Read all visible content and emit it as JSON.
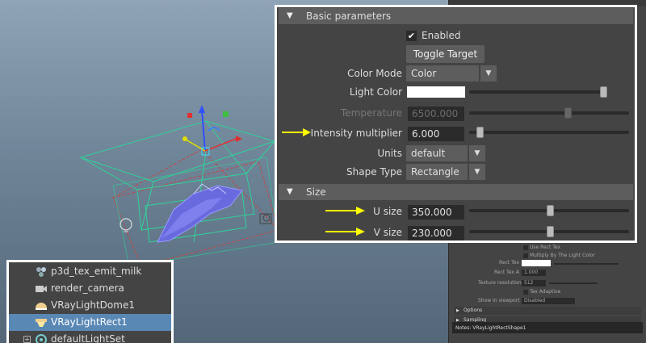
{
  "basic_parameters": {
    "header": "Basic parameters",
    "enabled_label": "Enabled",
    "enabled_checked": true,
    "toggle_target_label": "Toggle Target",
    "color_mode": {
      "label": "Color Mode",
      "value": "Color"
    },
    "light_color": {
      "label": "Light Color",
      "color": "#ffffff"
    },
    "temperature": {
      "label": "Temperature",
      "value": "6500.000"
    },
    "intensity_multiplier": {
      "label": "Intensity multiplier",
      "value": "6.000"
    },
    "units": {
      "label": "Units",
      "value": "default"
    },
    "shape_type": {
      "label": "Shape Type",
      "value": "Rectangle"
    }
  },
  "size": {
    "header": "Size",
    "u_size": {
      "label": "U size",
      "value": "350.000"
    },
    "v_size": {
      "label": "V size",
      "value": "230.000"
    }
  },
  "bg_editor": {
    "use_rect_tex": "Use Rect Tex",
    "multiply_by_light_color": "Multiply By The Light Color",
    "rect_tex": "Rect Tex",
    "rect_tex_a": "Rect Tex A",
    "rect_tex_a_value": "1.000",
    "texture_resolution": "Texture resolution",
    "texture_resolution_value": "512",
    "tex_adaptive": "Tex Adaptive",
    "show_in_viewport": "Show in viewport",
    "show_in_viewport_value": "Disabled",
    "options": "Options",
    "sampling": "Sampling",
    "notes": "Notes: VRayLightRectShape1"
  },
  "outliner": {
    "items": [
      {
        "label": "p3d_tex_emit_milk",
        "icon": "texture-node-icon"
      },
      {
        "label": "render_camera",
        "icon": "camera-icon"
      },
      {
        "label": "VRayLightDome1",
        "icon": "dome-light-icon"
      },
      {
        "label": "VRayLightRect1",
        "icon": "rect-light-icon",
        "selected": true
      },
      {
        "label": "defaultLightSet",
        "icon": "light-set-icon"
      }
    ]
  },
  "colors": {
    "panel_bg": "#444444",
    "section_header": "#5d5d5d",
    "field_bg": "#2b2b2b",
    "selection": "#5a88b5",
    "annotation_arrow": "#ffff00",
    "light_wireframe": "#2fd39a"
  }
}
